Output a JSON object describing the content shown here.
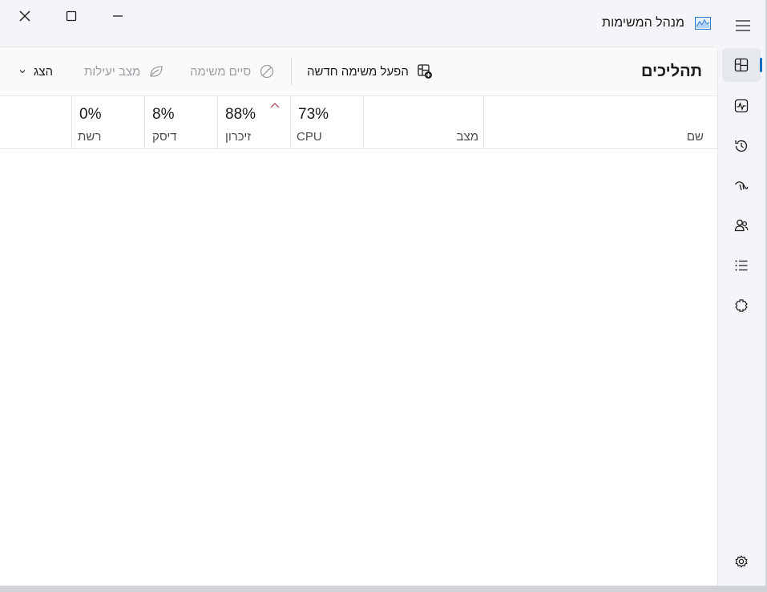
{
  "window": {
    "title": "מנהל המשימות",
    "controls": {
      "close": "close",
      "maximize": "maximize",
      "minimize": "minimize"
    }
  },
  "nav": {
    "items": [
      {
        "id": "processes",
        "icon": "processes-icon",
        "active": true
      },
      {
        "id": "performance",
        "icon": "performance-icon"
      },
      {
        "id": "app-history",
        "icon": "history-icon"
      },
      {
        "id": "startup-apps",
        "icon": "startup-icon"
      },
      {
        "id": "users",
        "icon": "users-icon"
      },
      {
        "id": "details",
        "icon": "details-list-icon"
      },
      {
        "id": "services",
        "icon": "services-icon"
      },
      {
        "id": "settings",
        "icon": "settings-gear-icon"
      }
    ]
  },
  "toolbar": {
    "page_title": "תהליכים",
    "run_new_task": "הפעל משימה חדשה",
    "end_task": "סיים משימה",
    "efficiency_mode": "מצב יעילות",
    "view": "הצג"
  },
  "table": {
    "columns": {
      "name": {
        "label": "שם"
      },
      "status": {
        "label": "מצב"
      },
      "cpu": {
        "label": "CPU",
        "value": "73%"
      },
      "memory": {
        "label": "זיכרון",
        "value": "88%"
      },
      "disk": {
        "label": "דיסק",
        "value": "8%"
      },
      "network": {
        "label": "רשת",
        "value": "0%"
      }
    },
    "sorted_column": "memory",
    "rows": []
  },
  "colors": {
    "accent": "#0f6cbd",
    "sort_caret": "#b3485a"
  }
}
